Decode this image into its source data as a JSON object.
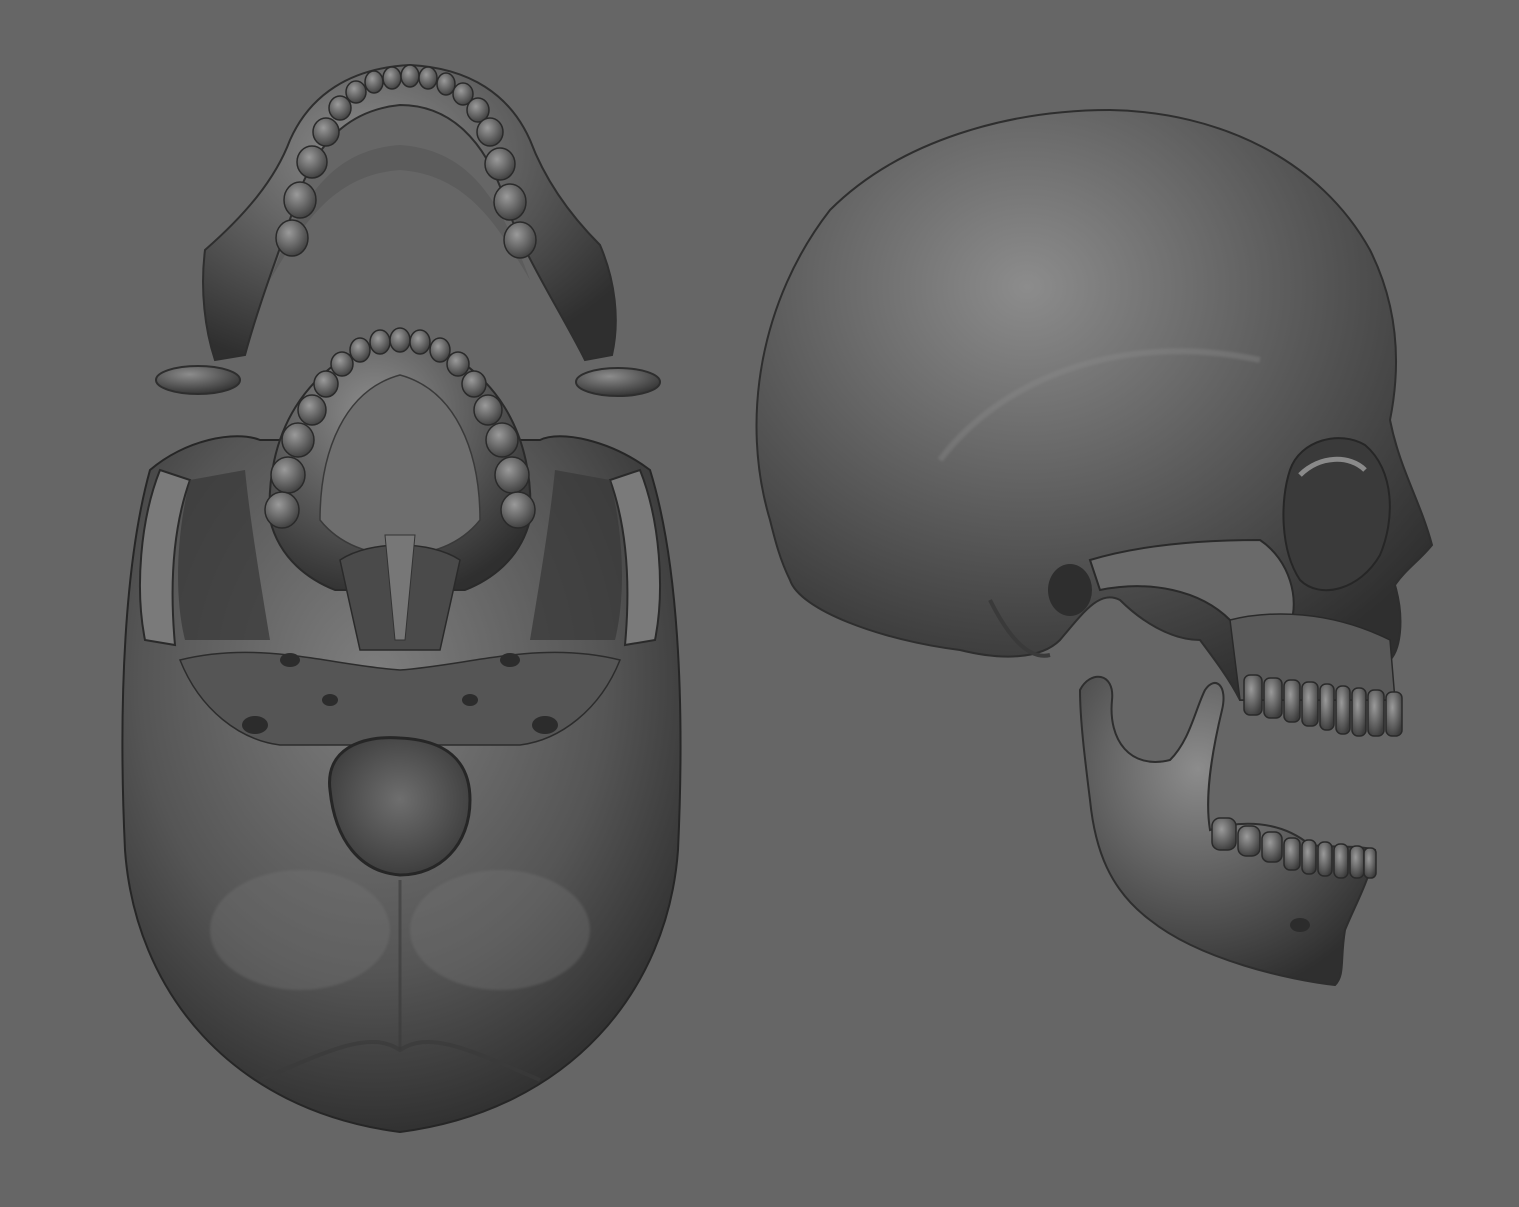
{
  "scene": {
    "background_color": "#666666",
    "bone_color": "#5e5e5e",
    "bone_highlight": "#8a8a8a",
    "bone_shadow": "#2e2e2e",
    "objects": [
      {
        "id": "mandible-top-view",
        "view": "superior",
        "part": "mandible"
      },
      {
        "id": "skull-bottom-view",
        "view": "inferior",
        "part": "cranium"
      },
      {
        "id": "skull-side-view",
        "view": "lateral-right",
        "part": "cranium"
      },
      {
        "id": "mandible-side-view",
        "view": "lateral-right",
        "part": "mandible"
      }
    ]
  }
}
